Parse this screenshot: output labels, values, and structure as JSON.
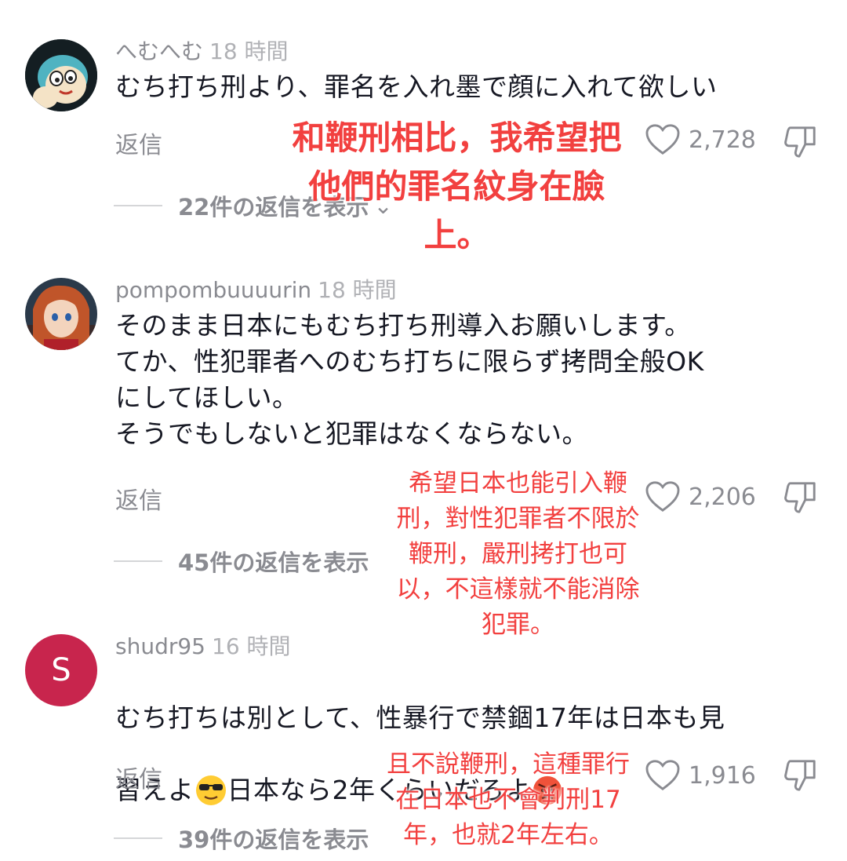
{
  "comments": [
    {
      "username": "へむへむ",
      "time": "18 時間",
      "text": "むち打ち刑より、罪名を入れ墨で顔に入れて欲しい",
      "reply_label": "返信",
      "likes": "2,728",
      "view_replies": "22件の返信を表示",
      "annotation": "和鞭刑相比，我希望把\n他們的罪名紋身在臉\n上。"
    },
    {
      "username": "pompombuuuurin",
      "time": "18 時間",
      "text": "そのまま日本にもむち打ち刑導入お願いします。\nてか、性犯罪者へのむち打ちに限らず拷問全般OK\nにしてほしい。\nそうでもしないと犯罪はなくならない。",
      "reply_label": "返信",
      "likes": "2,206",
      "view_replies": "45件の返信を表示",
      "annotation": "希望日本也能引入鞭\n刑，對性犯罪者不限於\n鞭刑，嚴刑拷打也可\n以，不這樣就不能消除\n犯罪。"
    },
    {
      "username": "shudr95",
      "time": "16 時間",
      "text_line1": "むち打ちは別として、性暴行で禁錮17年は日本も見",
      "text_line2a": "習えよ",
      "text_line2b": "日本なら2年くらいだろよ",
      "avatar_letter": "S",
      "reply_label": "返信",
      "likes": "1,916",
      "view_replies": "39件の返信を表示",
      "annotation": "且不說鞭刑，這種罪行\n在日本也不會判刑17\n年，也就2年左右。"
    }
  ],
  "icons": {
    "like": "heart-outline-icon",
    "dislike": "thumbs-down-icon",
    "expand": "chevron-down-icon",
    "emoji_1": "sunglasses-emoji",
    "emoji_2": "angry-face-emoji"
  },
  "colors": {
    "annotation": "#f2403f",
    "avatar_s_bg": "#c8254d"
  }
}
